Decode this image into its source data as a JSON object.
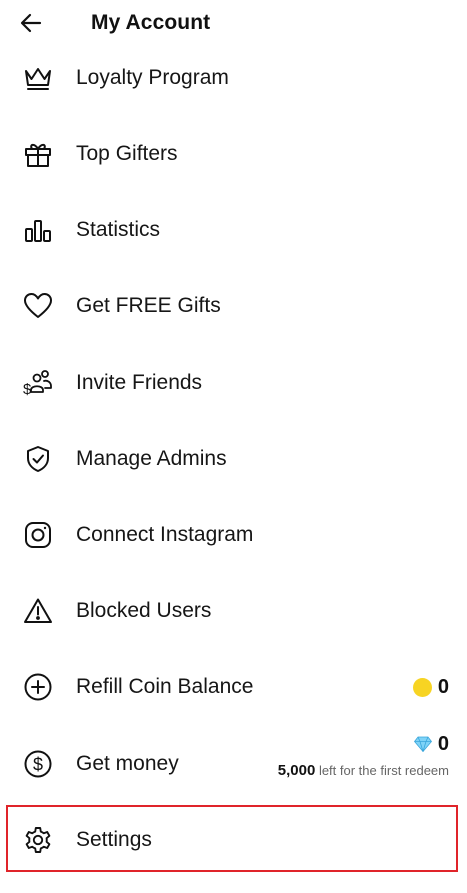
{
  "header": {
    "title": "My Account",
    "back_icon": "arrow-left-icon"
  },
  "menu": [
    {
      "id": "loyalty-program",
      "label": "Loyalty Program",
      "icon": "crown-icon"
    },
    {
      "id": "top-gifters",
      "label": "Top Gifters",
      "icon": "gift-icon"
    },
    {
      "id": "statistics",
      "label": "Statistics",
      "icon": "bar-chart-icon"
    },
    {
      "id": "get-free-gifts",
      "label": "Get FREE Gifts",
      "icon": "heart-icon"
    },
    {
      "id": "invite-friends",
      "label": "Invite Friends",
      "icon": "invite-friends-icon"
    },
    {
      "id": "manage-admins",
      "label": "Manage Admins",
      "icon": "shield-check-icon"
    },
    {
      "id": "connect-instagram",
      "label": "Connect Instagram",
      "icon": "instagram-icon"
    },
    {
      "id": "blocked-users",
      "label": "Blocked Users",
      "icon": "warning-triangle-icon"
    },
    {
      "id": "refill-coin-balance",
      "label": "Refill Coin Balance",
      "icon": "plus-circle-icon"
    },
    {
      "id": "get-money",
      "label": "Get money",
      "icon": "dollar-circle-icon"
    },
    {
      "id": "settings",
      "label": "Settings",
      "icon": "gear-icon"
    }
  ],
  "coin_balance": {
    "value": "0",
    "icon": "coin-icon",
    "color": "#f7d423"
  },
  "money_balance": {
    "value": "0",
    "icon": "diamond-icon",
    "redeem_amount": "5,000",
    "redeem_text": " left for the first redeem"
  },
  "highlight": {
    "target": "settings",
    "color": "#e0242a"
  }
}
